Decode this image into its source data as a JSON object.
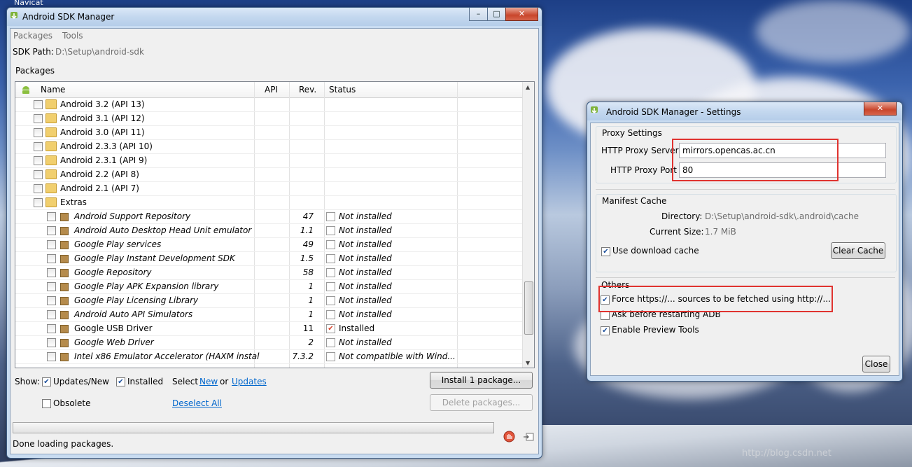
{
  "taskbar": {
    "label": "Navicat"
  },
  "main_window": {
    "title": "Android SDK Manager",
    "menu": [
      "Packages",
      "Tools"
    ],
    "sdk_path_label": "SDK Path:",
    "sdk_path_value": "D:\\Setup\\android-sdk",
    "packages_group_label": "Packages",
    "columns": {
      "name": "Name",
      "api": "API",
      "rev": "Rev.",
      "status": "Status"
    },
    "platform_rows": [
      {
        "name": "Android 3.2 (API 13)"
      },
      {
        "name": "Android 3.1 (API 12)"
      },
      {
        "name": "Android 3.0 (API 11)"
      },
      {
        "name": "Android 2.3.3 (API 10)"
      },
      {
        "name": "Android 2.3.1 (API 9)"
      },
      {
        "name": "Android 2.2 (API 8)"
      },
      {
        "name": "Android 2.1 (API 7)"
      },
      {
        "name": "Extras"
      }
    ],
    "extras_rows": [
      {
        "name": "Android Support Repository",
        "rev": "47",
        "status": "Not installed",
        "italic": true
      },
      {
        "name": "Android Auto Desktop Head Unit emulator",
        "rev": "1.1",
        "status": "Not installed",
        "italic": true
      },
      {
        "name": "Google Play services",
        "rev": "49",
        "status": "Not installed",
        "italic": true
      },
      {
        "name": "Google Play Instant Development SDK",
        "rev": "1.5",
        "status": "Not installed",
        "italic": true
      },
      {
        "name": "Google Repository",
        "rev": "58",
        "status": "Not installed",
        "italic": true
      },
      {
        "name": "Google Play APK Expansion library",
        "rev": "1",
        "status": "Not installed",
        "italic": true
      },
      {
        "name": "Google Play Licensing Library",
        "rev": "1",
        "status": "Not installed",
        "italic": true
      },
      {
        "name": "Android Auto API Simulators",
        "rev": "1",
        "status": "Not installed",
        "italic": true
      },
      {
        "name": "Google USB Driver",
        "rev": "11",
        "status": "Installed",
        "italic": false
      },
      {
        "name": "Google Web Driver",
        "rev": "2",
        "status": "Not installed",
        "italic": true
      },
      {
        "name": "Intel x86 Emulator Accelerator (HAXM instal",
        "rev": "7.3.2",
        "status": "Not compatible with Wind...",
        "italic": true
      }
    ],
    "show_label": "Show:",
    "updates_new_label": "Updates/New",
    "installed_label": "Installed",
    "select_label": "Select",
    "new_link": "New",
    "or_label": "or",
    "updates_link": "Updates",
    "obsolete_label": "Obsolete",
    "deselect_all_link": "Deselect All",
    "install_button": "Install 1 package...",
    "delete_button": "Delete packages...",
    "status_text": "Done loading packages."
  },
  "settings_dialog": {
    "title": "Android SDK Manager - Settings",
    "proxy_group": "Proxy Settings",
    "http_proxy_server_label": "HTTP Proxy Server",
    "http_proxy_server_value": "mirrors.opencas.ac.cn",
    "http_proxy_port_label": "HTTP Proxy Port",
    "http_proxy_port_value": "80",
    "manifest_group": "Manifest Cache",
    "directory_label": "Directory:",
    "directory_value": "D:\\Setup\\android-sdk\\.android\\cache",
    "current_size_label": "Current Size:",
    "current_size_value": "1.7 MiB",
    "use_download_cache": "Use download cache",
    "clear_cache_button": "Clear Cache",
    "others_group": "Others",
    "force_https": "Force https://... sources to be fetched using http://...",
    "ask_before_restart": "Ask before restarting ADB",
    "enable_preview": "Enable Preview Tools",
    "close_button": "Close"
  },
  "colors": {
    "highlight_box": "#e0332f",
    "link": "#0066cc",
    "title_bar": "#c4d8ef"
  }
}
